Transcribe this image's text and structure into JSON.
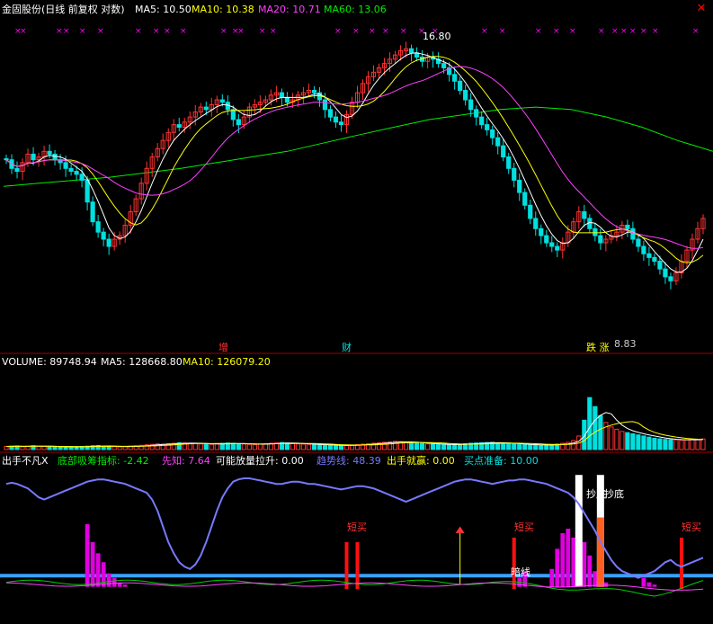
{
  "colors": {
    "background": "#000000",
    "up": "#ff3232",
    "down": "#00e0e0",
    "ma5": "#ffffff",
    "ma10": "#ffff00",
    "ma20": "#ff40ff",
    "ma60": "#00ee00",
    "purple_marks": "#ff00ff",
    "trend_line": "#7878ff",
    "separator": "#a00000"
  },
  "close_icon": "close-icon",
  "chart_data": [
    {
      "type": "candlestick",
      "panel": "price",
      "title": "金固股份(日线 前复权 对数)",
      "legend": [
        {
          "label": "MA5: 10.50",
          "color": "#ffffff"
        },
        {
          "label": "MA10: 10.38",
          "color": "#ffff00"
        },
        {
          "label": "MA20: 10.71",
          "color": "#ff40ff"
        },
        {
          "label": "MA60: 13.06",
          "color": "#00ee00"
        }
      ],
      "log_scale": true,
      "ylim": [
        7.5,
        17.8
      ],
      "x_count": 130,
      "close": [
        12.3,
        12.0,
        11.9,
        12.2,
        12.5,
        12.3,
        12.4,
        12.6,
        12.5,
        12.3,
        12.2,
        12.0,
        11.9,
        11.8,
        11.6,
        10.9,
        10.3,
        10.0,
        9.8,
        9.6,
        9.8,
        9.9,
        10.2,
        10.6,
        11.0,
        11.5,
        12.0,
        12.4,
        12.7,
        13.0,
        13.3,
        13.6,
        13.5,
        13.7,
        13.9,
        14.1,
        14.3,
        14.2,
        14.4,
        14.6,
        14.5,
        14.2,
        13.8,
        13.6,
        13.9,
        14.3,
        14.4,
        14.5,
        14.6,
        14.8,
        14.9,
        14.7,
        14.5,
        14.6,
        14.8,
        14.9,
        15.0,
        14.9,
        14.6,
        14.2,
        13.9,
        13.7,
        13.6,
        14.0,
        14.5,
        14.9,
        15.3,
        15.6,
        15.8,
        16.0,
        16.2,
        16.4,
        16.6,
        16.8,
        16.9,
        16.7,
        16.5,
        16.3,
        16.5,
        16.4,
        16.2,
        16.0,
        15.7,
        15.4,
        15.0,
        14.6,
        14.2,
        13.9,
        13.6,
        13.4,
        13.1,
        12.8,
        12.4,
        12.0,
        11.6,
        11.2,
        10.8,
        10.4,
        10.1,
        9.9,
        9.7,
        9.6,
        9.5,
        9.7,
        10.0,
        10.3,
        10.6,
        10.4,
        10.1,
        9.9,
        9.7,
        9.8,
        9.9,
        10.0,
        10.2,
        10.1,
        9.8,
        9.6,
        9.4,
        9.3,
        9.2,
        9.0,
        8.8,
        8.7,
        8.9,
        9.2,
        9.5,
        9.8,
        10.1,
        10.4
      ],
      "ma60_marks": [
        11.4,
        11.5,
        11.6,
        11.7,
        11.85,
        12.0,
        12.2,
        12.4,
        12.6,
        12.9,
        13.2,
        13.5,
        13.8,
        14.0,
        14.2,
        14.3,
        14.2,
        13.9,
        13.5,
        13.0,
        12.6
      ],
      "annotations": [
        {
          "text": "16.80",
          "kind": "high"
        },
        {
          "text": "8.83",
          "kind": "low"
        },
        {
          "text": "增",
          "kind": "event"
        },
        {
          "text": "财",
          "kind": "event"
        },
        {
          "text": "跌 涨",
          "kind": "event"
        }
      ]
    },
    {
      "type": "bar",
      "panel": "volume",
      "legend": [
        {
          "label": "VOLUME: 89748.94",
          "color": "#ffffff"
        },
        {
          "label": "MA5: 128668.80",
          "color": "#ffffff"
        },
        {
          "label": "MA10: 126079.20",
          "color": "#ffff00"
        }
      ],
      "ylim": [
        0,
        700000
      ],
      "values": [
        28,
        30,
        32,
        25,
        30,
        34,
        30,
        28,
        26,
        24,
        22,
        24,
        26,
        25,
        27,
        30,
        34,
        36,
        30,
        28,
        26,
        24,
        26,
        30,
        34,
        38,
        42,
        46,
        50,
        48,
        52,
        56,
        60,
        58,
        56,
        54,
        50,
        48,
        46,
        50,
        54,
        58,
        56,
        52,
        48,
        46,
        44,
        48,
        52,
        56,
        60,
        62,
        58,
        54,
        50,
        48,
        46,
        44,
        42,
        40,
        38,
        36,
        34,
        36,
        40,
        44,
        48,
        52,
        56,
        60,
        64,
        68,
        72,
        70,
        66,
        62,
        58,
        54,
        50,
        48,
        46,
        44,
        42,
        44,
        48,
        52,
        56,
        58,
        60,
        62,
        64,
        60,
        56,
        52,
        48,
        46,
        44,
        42,
        40,
        38,
        40,
        44,
        48,
        56,
        64,
        80,
        120,
        260,
        460,
        380,
        300,
        240,
        200,
        180,
        160,
        150,
        140,
        130,
        120,
        110,
        100,
        95,
        90,
        88,
        86,
        84,
        86,
        88,
        90,
        94
      ]
    },
    {
      "type": "line",
      "panel": "indicator",
      "title": "出手不凡X",
      "legend": [
        {
          "label": "底部吸筹指标: -2.42",
          "color": "#00ee00"
        },
        {
          "label": "先知: 7.64",
          "color": "#ff40ff"
        },
        {
          "label": "可能放量拉升: 0.00",
          "color": "#ffffff"
        },
        {
          "label": "趋势线: 48.39",
          "color": "#7878ff"
        },
        {
          "label": "出手就赢: 0.00",
          "color": "#ffff00"
        },
        {
          "label": "买点准备: 10.00",
          "color": "#00e0e0"
        }
      ],
      "ylim": [
        -30,
        105
      ],
      "trend": [
        92,
        93,
        92,
        90,
        88,
        84,
        80,
        78,
        80,
        82,
        84,
        86,
        88,
        90,
        92,
        94,
        95,
        96,
        96,
        95,
        94,
        93,
        92,
        90,
        88,
        86,
        84,
        78,
        68,
        54,
        40,
        30,
        22,
        18,
        16,
        20,
        28,
        40,
        54,
        68,
        80,
        88,
        94,
        96,
        97,
        97,
        96,
        95,
        94,
        93,
        92,
        92,
        93,
        94,
        94,
        93,
        92,
        92,
        91,
        90,
        89,
        88,
        87,
        88,
        89,
        90,
        90,
        89,
        88,
        86,
        84,
        82,
        80,
        78,
        76,
        78,
        80,
        82,
        84,
        86,
        88,
        90,
        92,
        94,
        95,
        96,
        96,
        95,
        94,
        93,
        92,
        93,
        94,
        95,
        95,
        96,
        96,
        95,
        94,
        93,
        92,
        90,
        88,
        86,
        84,
        80,
        74,
        66,
        58,
        50,
        40,
        32,
        24,
        18,
        14,
        12,
        10,
        8,
        10,
        12,
        14,
        18,
        22,
        24,
        20,
        18,
        20,
        22,
        24,
        26
      ],
      "event_labels": [
        "短买",
        "短买",
        "短买",
        "抄底",
        "抄底",
        "暗线"
      ]
    }
  ]
}
